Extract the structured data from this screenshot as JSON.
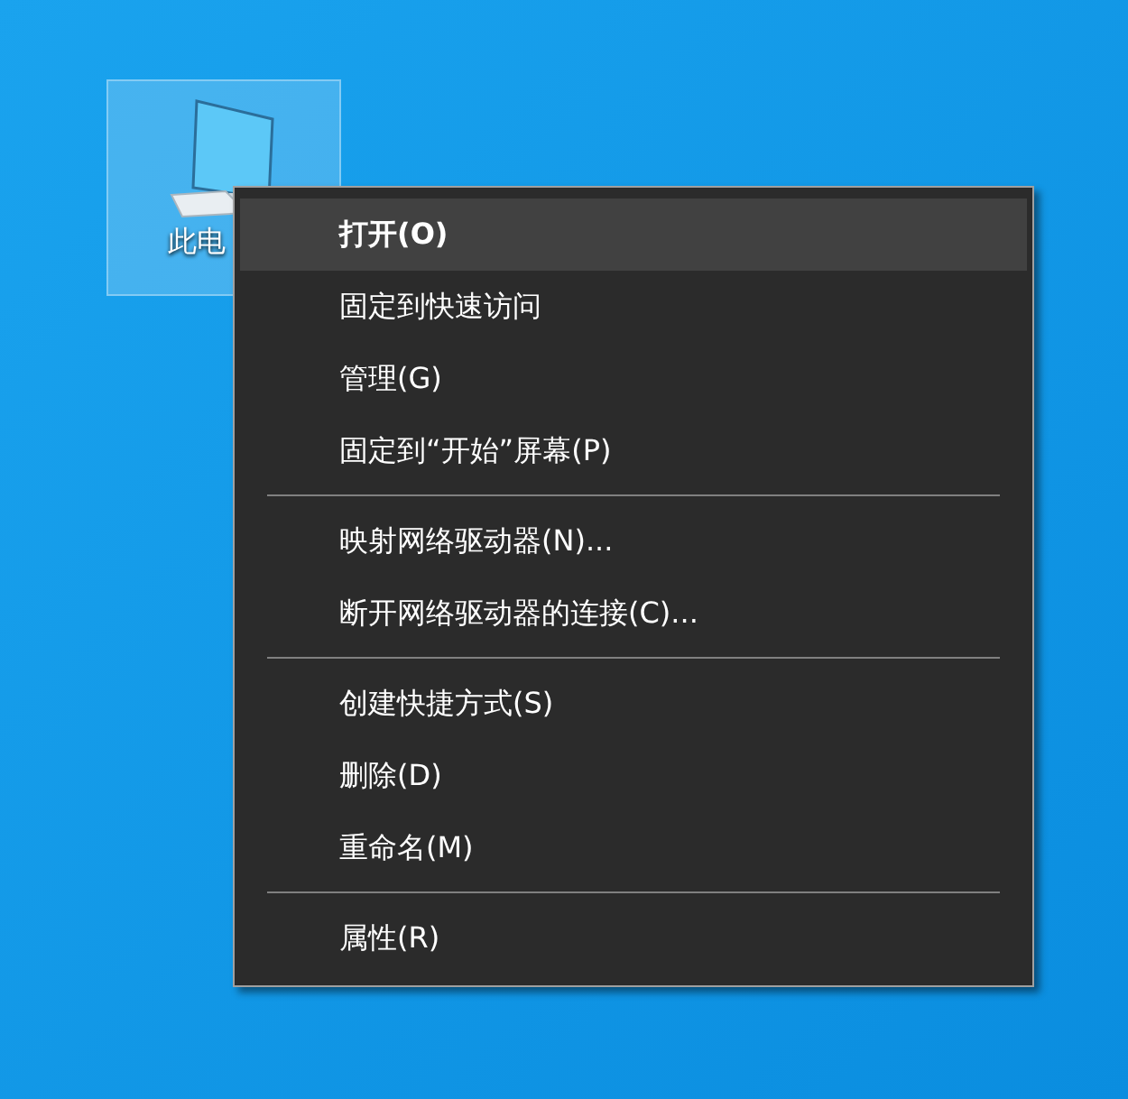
{
  "desktop_icon": {
    "label": "此电",
    "selected": true
  },
  "context_menu": {
    "groups": [
      [
        {
          "label": "打开(O)",
          "bold": true,
          "highlighted": true
        },
        {
          "label": "固定到快速访问",
          "bold": false,
          "highlighted": false
        },
        {
          "label": "管理(G)",
          "bold": false,
          "highlighted": false
        },
        {
          "label": "固定到“开始”屏幕(P)",
          "bold": false,
          "highlighted": false
        }
      ],
      [
        {
          "label": "映射网络驱动器(N)...",
          "bold": false,
          "highlighted": false
        },
        {
          "label": "断开网络驱动器的连接(C)...",
          "bold": false,
          "highlighted": false
        }
      ],
      [
        {
          "label": "创建快捷方式(S)",
          "bold": false,
          "highlighted": false
        },
        {
          "label": "删除(D)",
          "bold": false,
          "highlighted": false
        },
        {
          "label": "重命名(M)",
          "bold": false,
          "highlighted": false
        }
      ],
      [
        {
          "label": "属性(R)",
          "bold": false,
          "highlighted": false
        }
      ]
    ]
  }
}
